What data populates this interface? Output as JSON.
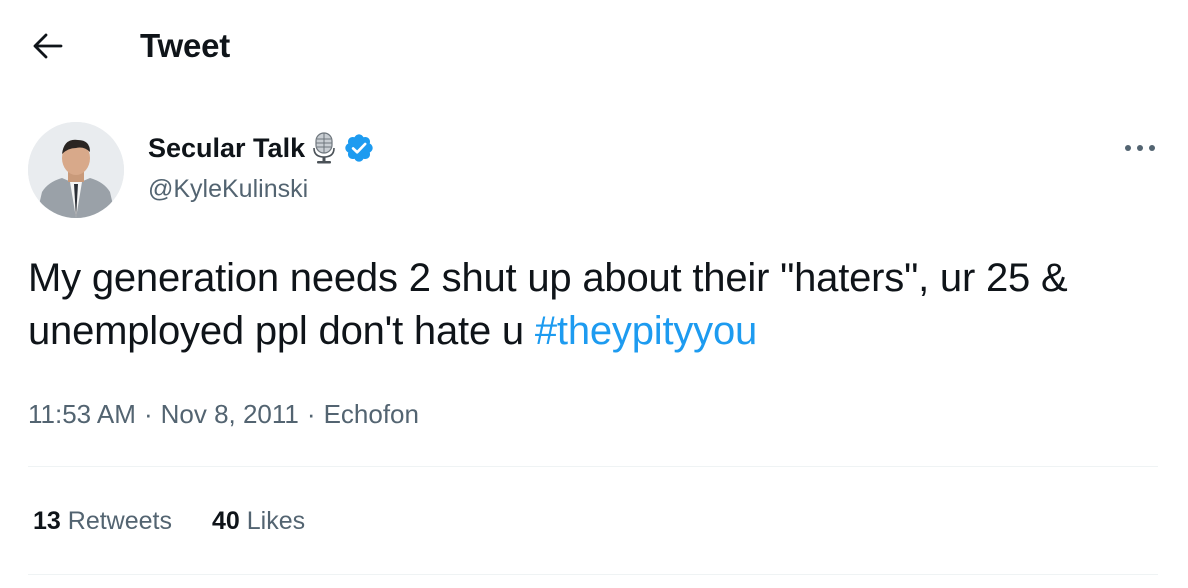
{
  "header": {
    "title": "Tweet",
    "back_icon": "arrow-left-icon"
  },
  "author": {
    "display_name": "Secular Talk",
    "emoji_icon": "microphone-icon",
    "verified_icon": "verified-badge-icon",
    "handle": "@KyleKulinski"
  },
  "tweet": {
    "text": "My generation needs 2 shut up about their \"haters\", ur 25 & unemployed ppl don't hate u ",
    "hashtag": "#theypityyou",
    "time": "11:53 AM",
    "date": "Nov 8, 2011",
    "source": "Echofon",
    "separator": "·"
  },
  "stats": {
    "retweets_count": "13",
    "retweets_label": "Retweets",
    "likes_count": "40",
    "likes_label": "Likes"
  },
  "colors": {
    "text": "#0f1419",
    "secondary": "#536471",
    "accent": "#1d9bf0",
    "divider": "#eff3f4"
  }
}
